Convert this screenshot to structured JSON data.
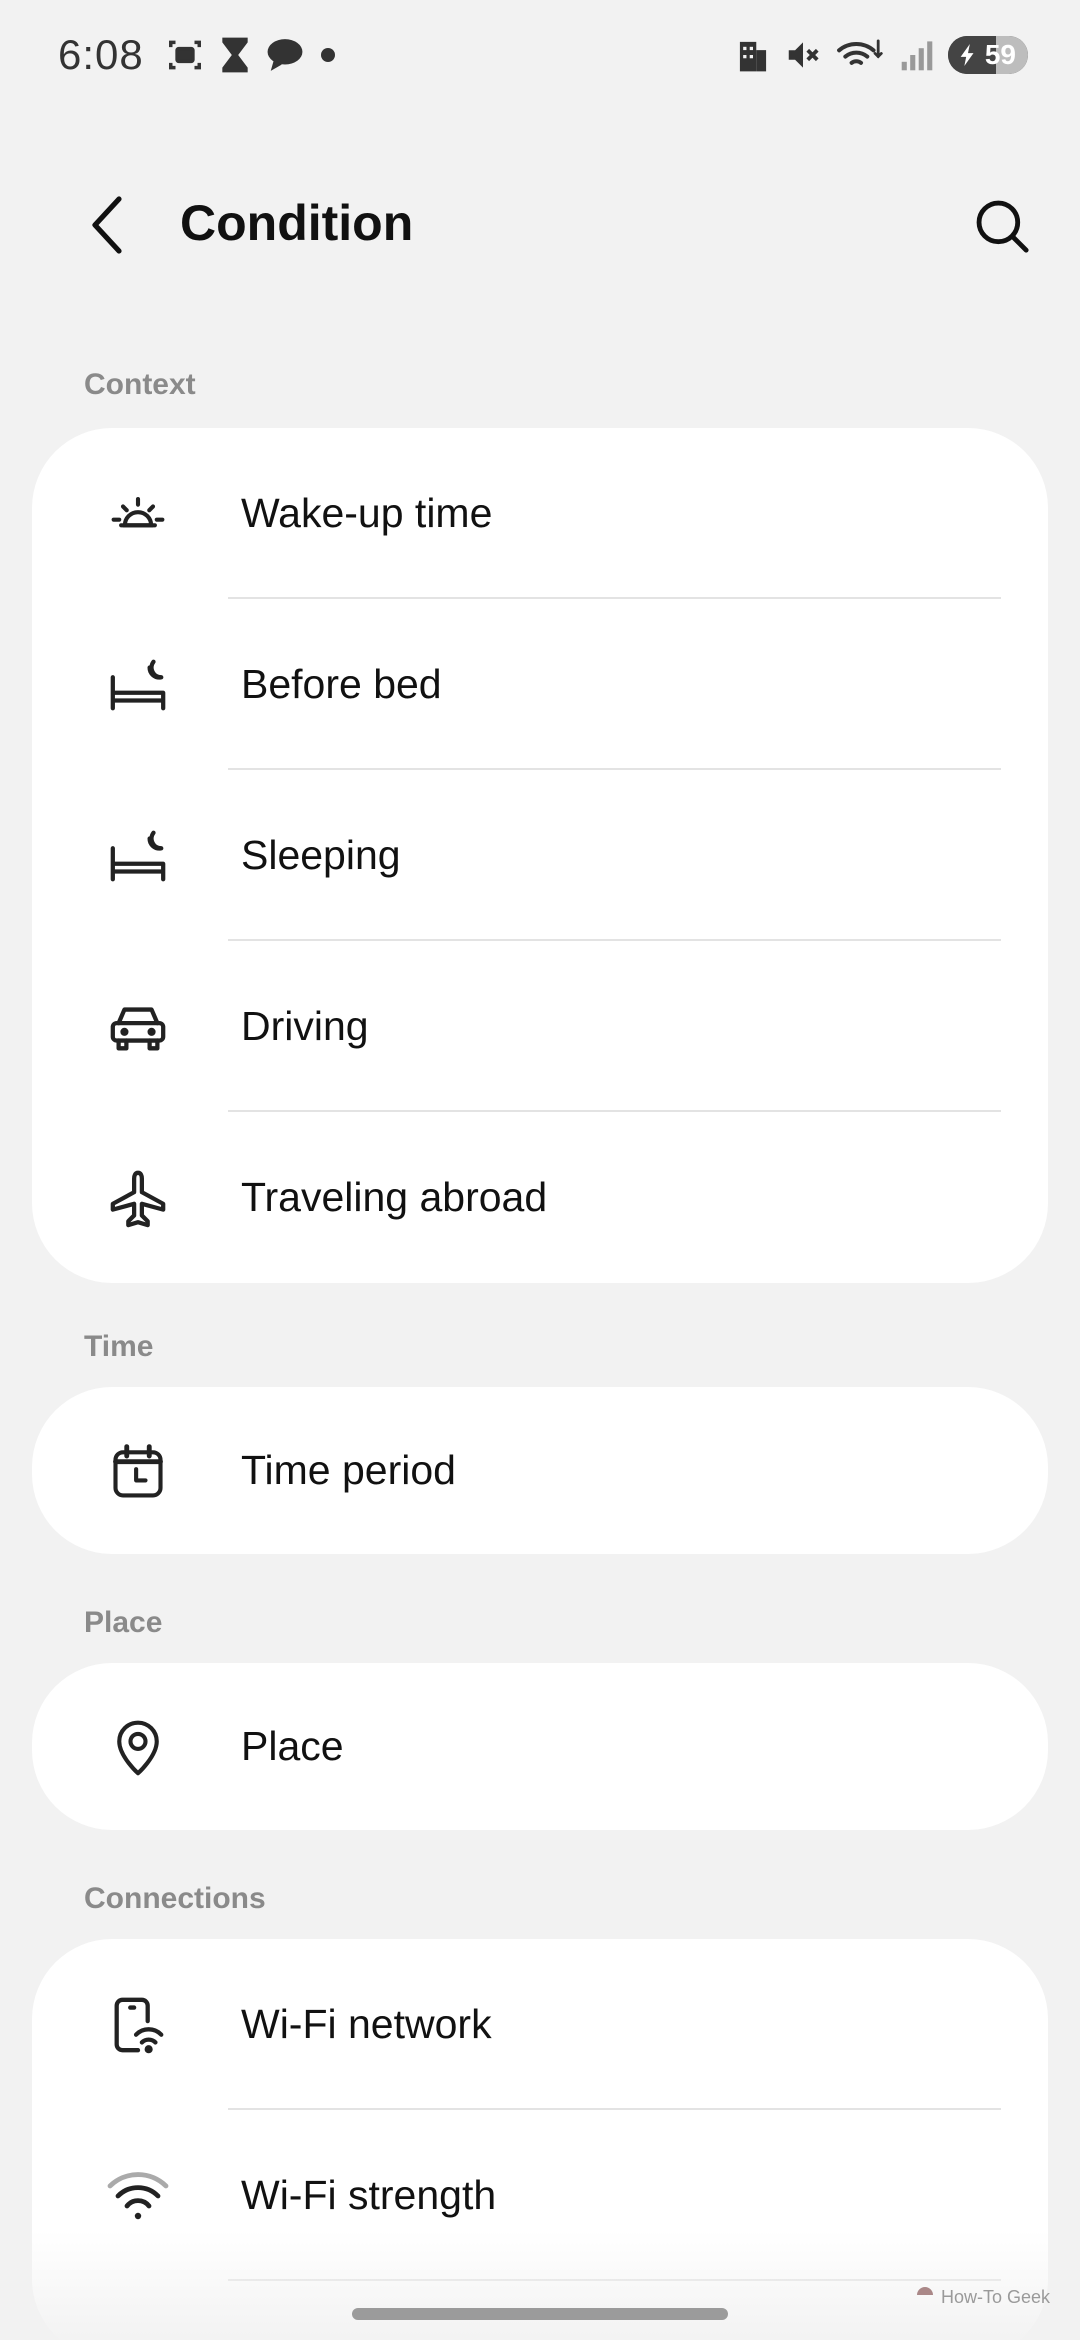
{
  "status_bar": {
    "time": "6:08",
    "battery_level": "59"
  },
  "app_bar": {
    "title": "Condition"
  },
  "sections": {
    "context": {
      "header": "Context",
      "items": [
        {
          "label": "Wake-up time",
          "icon": "sunrise-icon"
        },
        {
          "label": "Before bed",
          "icon": "bed-moon-icon"
        },
        {
          "label": "Sleeping",
          "icon": "bed-moon-icon"
        },
        {
          "label": "Driving",
          "icon": "car-icon"
        },
        {
          "label": "Traveling abroad",
          "icon": "airplane-icon"
        }
      ]
    },
    "time": {
      "header": "Time",
      "items": [
        {
          "label": "Time period",
          "icon": "calendar-clock-icon"
        }
      ]
    },
    "place": {
      "header": "Place",
      "items": [
        {
          "label": "Place",
          "icon": "location-pin-icon"
        }
      ]
    },
    "connections": {
      "header": "Connections",
      "items": [
        {
          "label": "Wi-Fi network",
          "icon": "phone-wifi-icon"
        },
        {
          "label": "Wi-Fi strength",
          "icon": "wifi-icon"
        }
      ]
    }
  },
  "watermark": "How-To Geek",
  "colors": {
    "background": "#f2f2f2",
    "card": "#ffffff",
    "section_header": "#8a8a8a",
    "divider": "#e3e3e3"
  }
}
